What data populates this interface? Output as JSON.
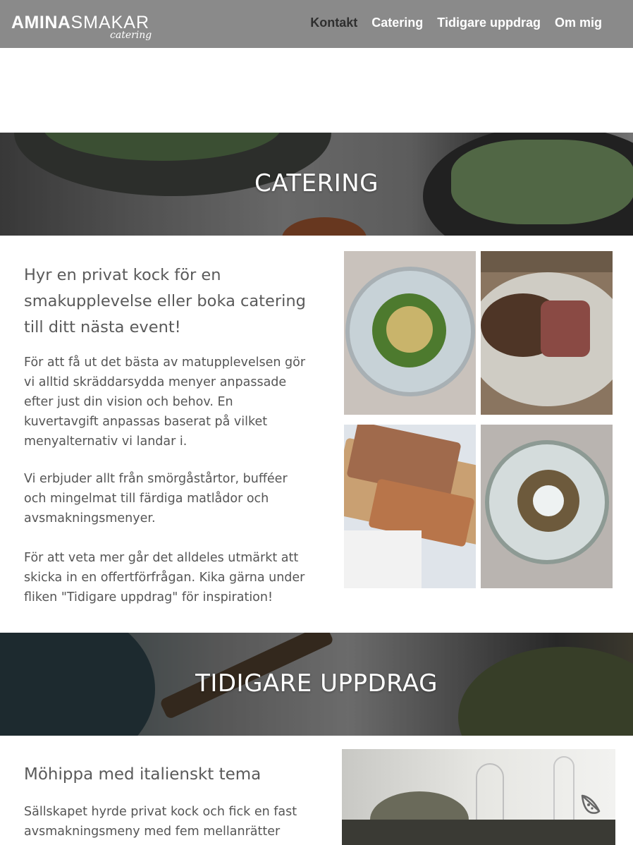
{
  "header": {
    "logo": {
      "part1": "AMINA",
      "part2": "SMAKAR",
      "tagline": "catering"
    },
    "nav": [
      {
        "label": "Kontakt",
        "active": true
      },
      {
        "label": "Catering",
        "active": false
      },
      {
        "label": "Tidigare uppdrag",
        "active": false
      },
      {
        "label": "Om mig",
        "active": false
      }
    ]
  },
  "catering": {
    "banner_title": "CATERING",
    "heading": "Hyr en privat kock för en smakupplevelse eller boka catering till ditt nästa event!",
    "paragraphs": [
      "För att få ut det bästa av matupplevelsen gör vi alltid skräddarsydda menyer anpassade efter just din vision och behov. En kuvertavgift anpassas baserat på vilket menyalternativ vi landar i.",
      "Vi erbjuder allt från smörgåstårtor, bufféer och mingelmat till färdiga matlådor och avsmakningsmenyer.",
      "För att veta mer går det alldeles utmärkt att skicka in en offertförfrågan. Kika gärna under fliken \"Tidigare uppdrag\" för inspiration!"
    ]
  },
  "previous": {
    "banner_title": "TIDIGARE UPPDRAG",
    "event_title": "Möhippa med italienskt tema",
    "event_text": "Sällskapet hyrde privat kock och fick en fast avsmakningsmeny med fem mellanrätter och"
  },
  "icons": {
    "floating": "pizza-slice-icon"
  },
  "colors": {
    "header_bg": "#8a8a8a",
    "nav_active": "#2f2f2f"
  }
}
